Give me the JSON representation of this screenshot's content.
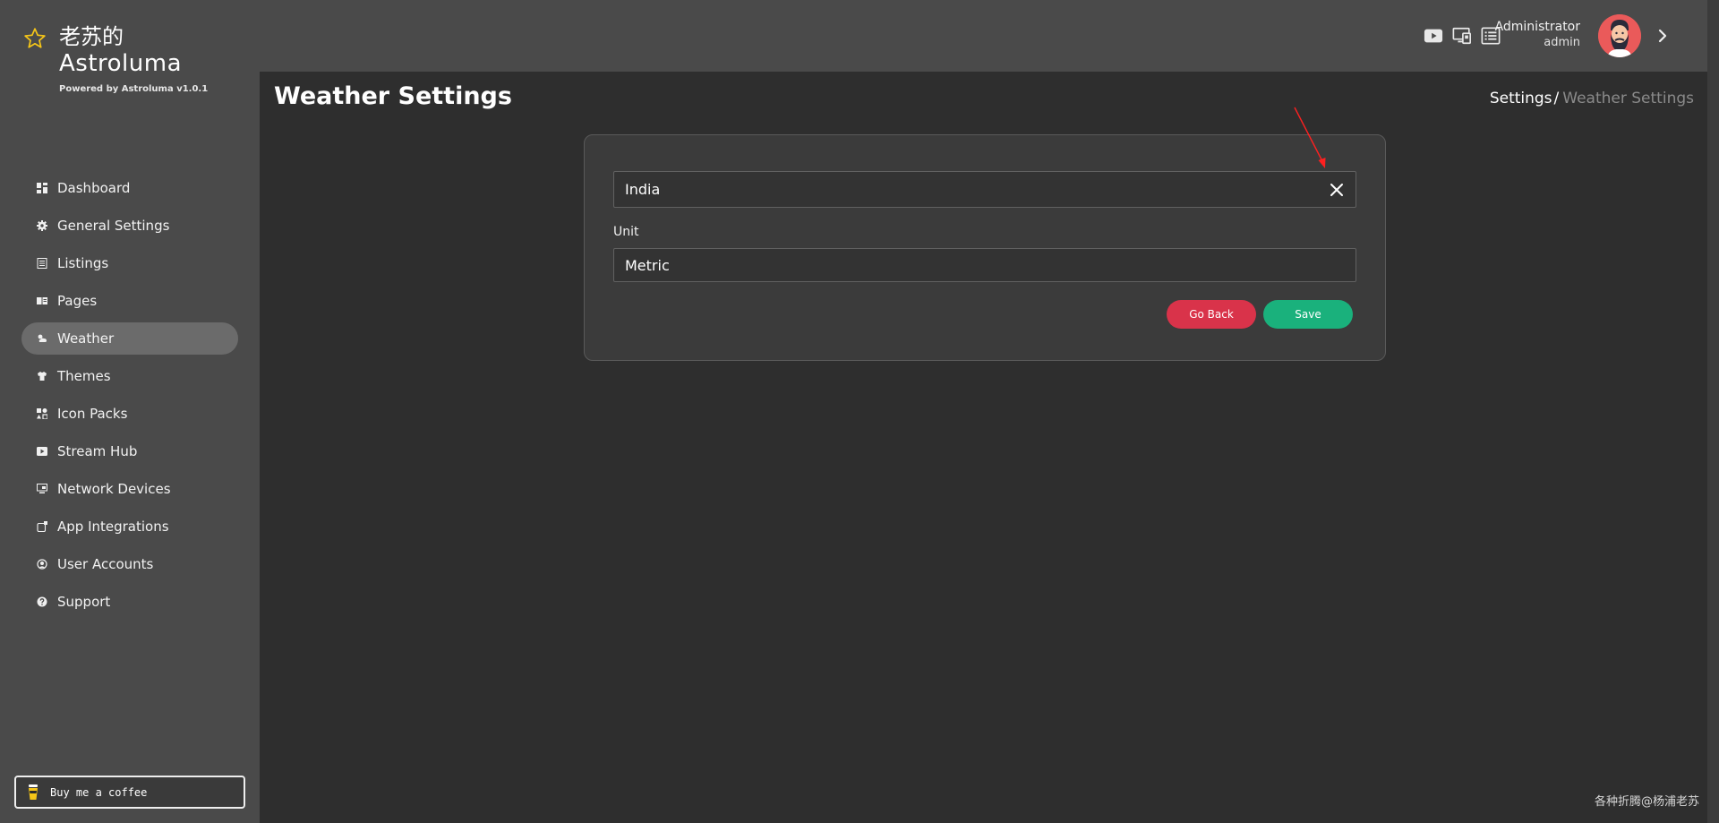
{
  "brand": {
    "title_cn": "老苏的",
    "title_en": "Astroluma",
    "subtitle": "Powered by Astroluma v1.0.1"
  },
  "sidebar": {
    "items": [
      {
        "label": "Dashboard",
        "icon": "dashboard-icon"
      },
      {
        "label": "General Settings",
        "icon": "gear-icon"
      },
      {
        "label": "Listings",
        "icon": "list-icon"
      },
      {
        "label": "Pages",
        "icon": "book-icon"
      },
      {
        "label": "Weather",
        "icon": "cloud-sun-icon",
        "active": true
      },
      {
        "label": "Themes",
        "icon": "shirt-icon"
      },
      {
        "label": "Icon Packs",
        "icon": "icons-icon"
      },
      {
        "label": "Stream Hub",
        "icon": "play-icon"
      },
      {
        "label": "Network Devices",
        "icon": "network-icon"
      },
      {
        "label": "App Integrations",
        "icon": "plug-icon"
      },
      {
        "label": "User Accounts",
        "icon": "user-icon"
      },
      {
        "label": "Support",
        "icon": "help-icon"
      }
    ],
    "coffee_label": "Buy me a coffee"
  },
  "header": {
    "user_name": "Administrator",
    "user_role": "admin",
    "icons": [
      "youtube-icon",
      "devices-icon",
      "list-box-icon"
    ]
  },
  "page": {
    "title": "Weather Settings",
    "breadcrumb": [
      "Settings",
      "/",
      "Weather Settings"
    ]
  },
  "form": {
    "location_value": "India",
    "unit_label": "Unit",
    "unit_value": "Metric",
    "back_label": "Go Back",
    "save_label": "Save"
  },
  "watermark": "各种折腾@杨浦老苏",
  "colors": {
    "accent_save": "#1ab17c",
    "accent_back": "#d9334a",
    "star": "#f5c518",
    "annotation_arrow": "#ff2020"
  }
}
